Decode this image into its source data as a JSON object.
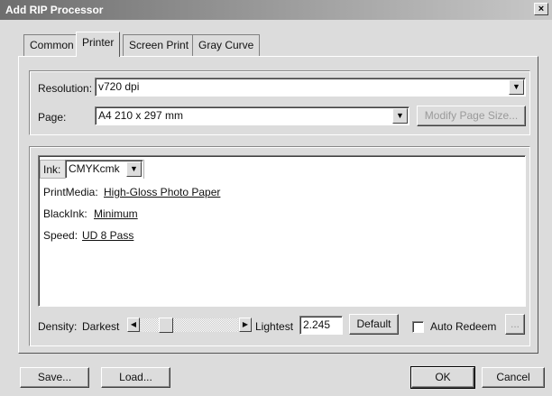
{
  "window": {
    "title": "Add RIP Processor",
    "close_glyph": "×"
  },
  "tabs": [
    {
      "label": "Common",
      "active": false
    },
    {
      "label": "Printer",
      "active": true
    },
    {
      "label": "Screen Print",
      "active": false
    },
    {
      "label": "Gray Curve",
      "active": false
    }
  ],
  "printer": {
    "resolution_label": "Resolution:",
    "resolution_value": "v720 dpi",
    "page_label": "Page:",
    "page_value": "A4 210 x 297 mm",
    "modify_page_size_label": "Modify Page Size..."
  },
  "settings": {
    "ink_label": "Ink:",
    "ink_value": "CMYKcmk",
    "print_media_label": "PrintMedia:",
    "print_media_value": "High-Gloss Photo Paper",
    "black_ink_label": "BlackInk:",
    "black_ink_value": "Minimum",
    "speed_label": "Speed:",
    "speed_value": "UD 8 Pass"
  },
  "density": {
    "label": "Density:",
    "darkest_label": "Darkest",
    "lightest_label": "Lightest",
    "value": "2.245",
    "slider_fraction": 0.22,
    "default_label": "Default",
    "auto_redeem_label": "Auto Redeem",
    "auto_redeem_checked": false,
    "ellipsis_label": "..."
  },
  "footer": {
    "save_label": "Save...",
    "load_label": "Load...",
    "ok_label": "OK",
    "cancel_label": "Cancel"
  },
  "icons": {
    "dropdown": "chevron-down-icon",
    "left": "arrow-left-icon",
    "right": "arrow-right-icon",
    "close": "close-icon"
  }
}
